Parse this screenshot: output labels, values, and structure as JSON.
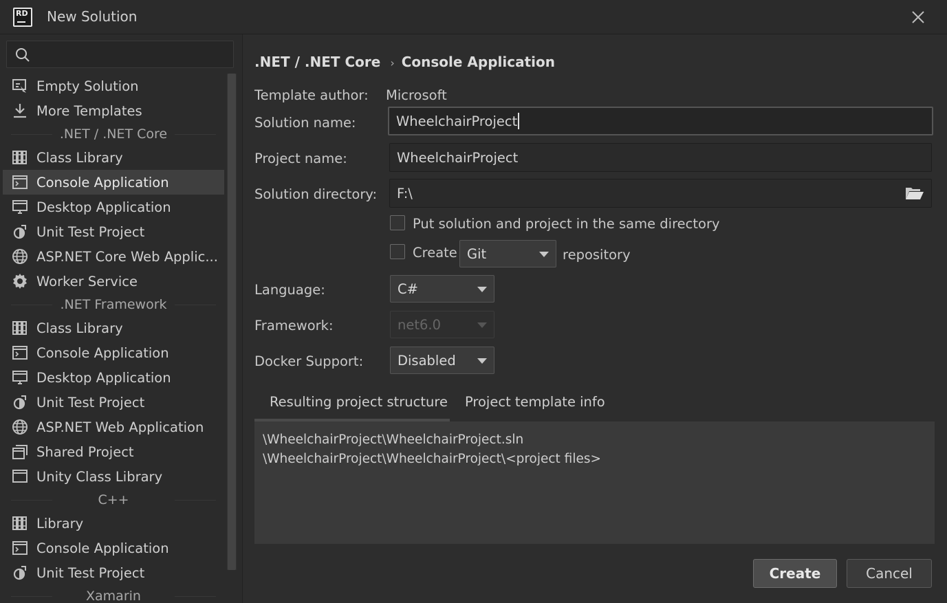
{
  "window": {
    "logo_text": "RD",
    "title": "New Solution"
  },
  "sidebar": {
    "search": {
      "value": "",
      "placeholder": ""
    },
    "entries": [
      {
        "kind": "item",
        "label": "Empty Solution",
        "icon": "empty-solution-icon"
      },
      {
        "kind": "item",
        "label": "More Templates",
        "icon": "download-icon"
      },
      {
        "kind": "group",
        "label": ".NET / .NET Core"
      },
      {
        "kind": "item",
        "label": "Class Library",
        "icon": "class-library-icon"
      },
      {
        "kind": "item",
        "label": "Console Application",
        "icon": "console-icon",
        "selected": true
      },
      {
        "kind": "item",
        "label": "Desktop Application",
        "icon": "desktop-icon"
      },
      {
        "kind": "item",
        "label": "Unit Test Project",
        "icon": "unit-test-icon"
      },
      {
        "kind": "item",
        "label": "ASP.NET Core Web Applic...",
        "icon": "globe-icon"
      },
      {
        "kind": "item",
        "label": "Worker Service",
        "icon": "gear-icon"
      },
      {
        "kind": "group",
        "label": ".NET Framework"
      },
      {
        "kind": "item",
        "label": "Class Library",
        "icon": "class-library-icon"
      },
      {
        "kind": "item",
        "label": "Console Application",
        "icon": "console-icon"
      },
      {
        "kind": "item",
        "label": "Desktop Application",
        "icon": "desktop-icon"
      },
      {
        "kind": "item",
        "label": "Unit Test Project",
        "icon": "unit-test-icon"
      },
      {
        "kind": "item",
        "label": "ASP.NET Web Application",
        "icon": "globe-icon"
      },
      {
        "kind": "item",
        "label": "Shared Project",
        "icon": "shared-project-icon"
      },
      {
        "kind": "item",
        "label": "Unity Class Library",
        "icon": "window-icon"
      },
      {
        "kind": "group",
        "label": "C++"
      },
      {
        "kind": "item",
        "label": "Library",
        "icon": "class-library-icon"
      },
      {
        "kind": "item",
        "label": "Console Application",
        "icon": "console-icon"
      },
      {
        "kind": "item",
        "label": "Unit Test Project",
        "icon": "unit-test-icon"
      },
      {
        "kind": "group",
        "label": "Xamarin"
      }
    ]
  },
  "main": {
    "breadcrumb": {
      "parent": ".NET / .NET Core",
      "separator": "›",
      "current": "Console Application"
    },
    "template_author": {
      "label": "Template author:",
      "value": "Microsoft"
    },
    "solution_name": {
      "label": "Solution name:",
      "value": "WheelchairProject"
    },
    "project_name": {
      "label": "Project name:",
      "value": "WheelchairProject"
    },
    "solution_directory": {
      "label": "Solution directory:",
      "value": "F:\\"
    },
    "same_directory": {
      "label": "Put solution and project in the same directory",
      "checked": false
    },
    "create_repo": {
      "prefix": "Create",
      "vcs": "Git",
      "suffix": "repository",
      "checked": false
    },
    "language": {
      "label": "Language:",
      "value": "C#"
    },
    "framework": {
      "label": "Framework:",
      "value": "net6.0",
      "disabled": true
    },
    "docker": {
      "label": "Docker Support:",
      "value": "Disabled"
    },
    "tabs": [
      {
        "label": "Resulting project structure",
        "active": true
      },
      {
        "label": "Project template info",
        "active": false
      }
    ],
    "structure_lines": [
      "\\WheelchairProject\\WheelchairProject.sln",
      "\\WheelchairProject\\WheelchairProject\\<project files>"
    ],
    "buttons": {
      "create": "Create",
      "cancel": "Cancel"
    }
  }
}
